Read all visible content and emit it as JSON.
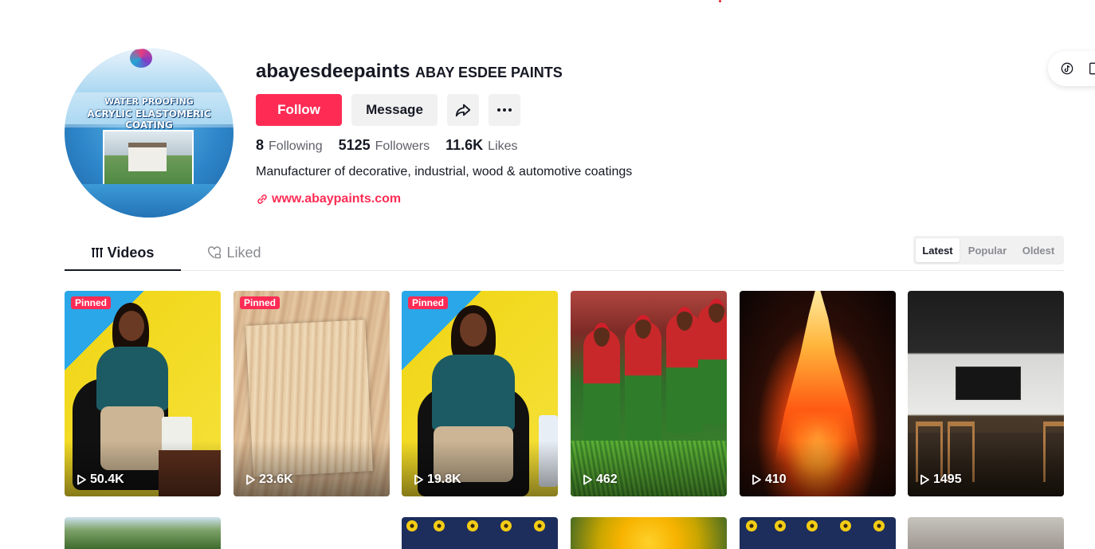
{
  "profile": {
    "username": "abayesdeepaints",
    "nickname": "ABAY ESDEE PAINTS",
    "avatar": {
      "line1": "WATER PROOFING",
      "line2": "ACRYLIC ELASTOMERIC COATING"
    },
    "buttons": {
      "follow": "Follow",
      "message": "Message",
      "share_icon": "share-icon",
      "more_icon": "more-icon"
    },
    "stats": {
      "following_count": "8",
      "following_label": "Following",
      "followers_count": "5125",
      "followers_label": "Followers",
      "likes_count": "11.6K",
      "likes_label": "Likes"
    },
    "bio": "Manufacturer of decorative, industrial, wood & automotive coatings",
    "link": "www.abaypaints.com"
  },
  "tabs": [
    {
      "label": "Videos",
      "icon": "grid-icon",
      "active": true
    },
    {
      "label": "Liked",
      "icon": "heart-lock-icon",
      "active": false
    }
  ],
  "sort": {
    "options": [
      "Latest",
      "Popular",
      "Oldest"
    ],
    "active": "Latest"
  },
  "videos": [
    {
      "pinned": "Pinned",
      "views": "50.4K"
    },
    {
      "pinned": "Pinned",
      "views": "23.6K"
    },
    {
      "pinned": "Pinned",
      "views": "19.8K"
    },
    {
      "pinned": "",
      "views": "462"
    },
    {
      "pinned": "",
      "views": "410"
    },
    {
      "pinned": "",
      "views": "1495"
    }
  ],
  "colors": {
    "accent": "#fe2c55",
    "text": "#161823",
    "muted": "#8a8b91",
    "button_gray": "#f1f1f2"
  }
}
